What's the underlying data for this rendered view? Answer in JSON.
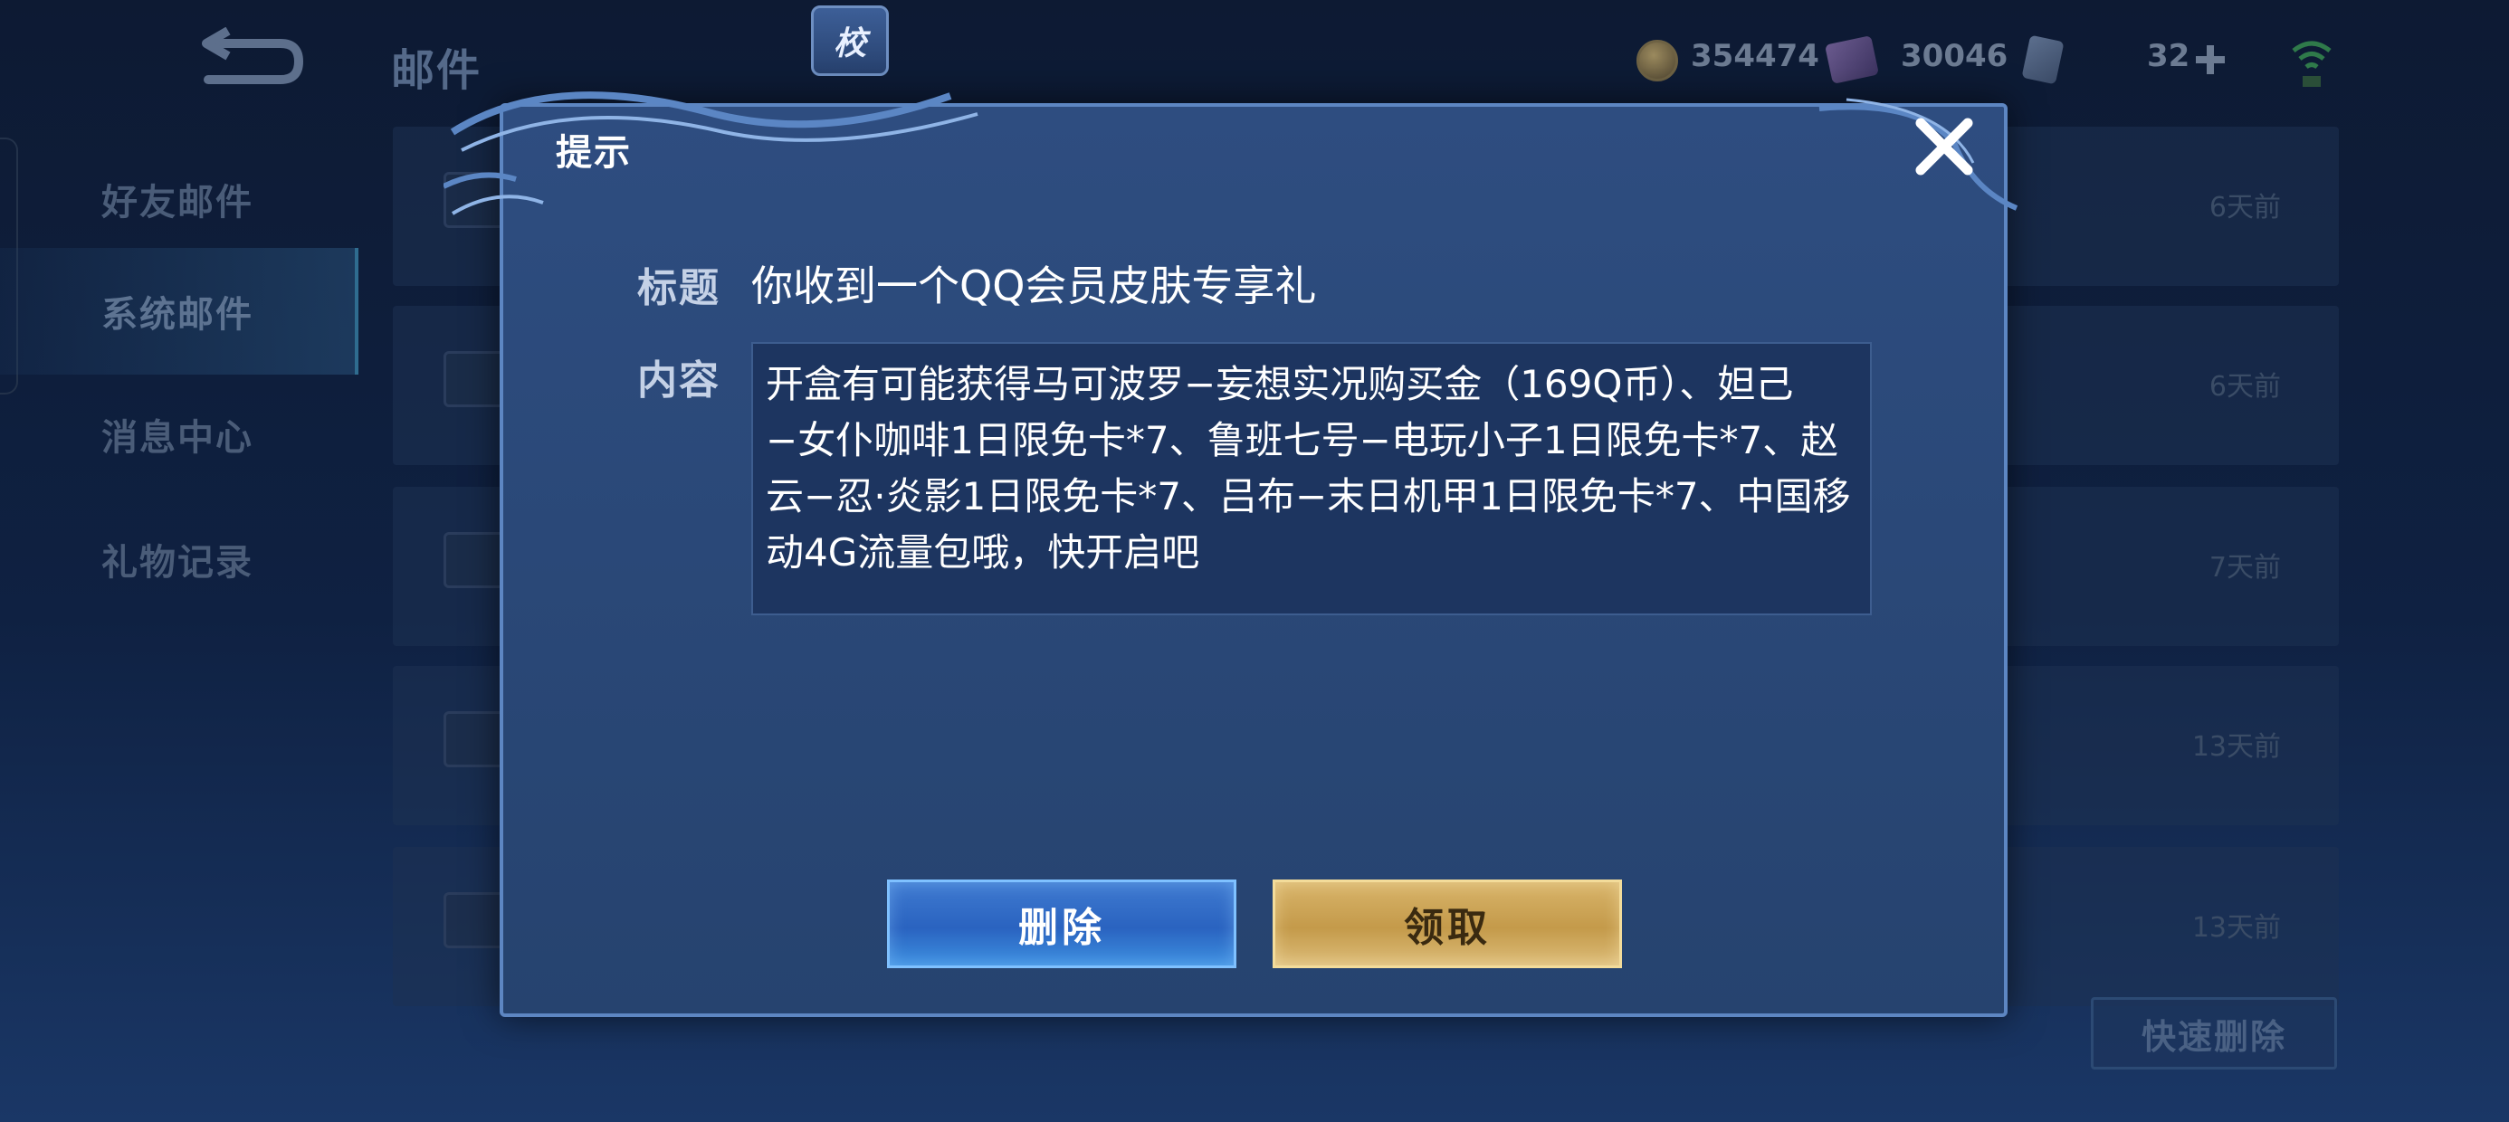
{
  "header": {
    "title": "邮件",
    "badge_glyph": "校",
    "coins": "354474",
    "gems": "30046",
    "tickets": "32"
  },
  "sidebar": {
    "items": [
      {
        "label": "好友邮件",
        "active": false
      },
      {
        "label": "系统邮件",
        "active": true
      },
      {
        "label": "消息中心",
        "active": false
      },
      {
        "label": "礼物记录",
        "active": false
      }
    ]
  },
  "mail_list": {
    "rows": [
      {
        "time": "6天前"
      },
      {
        "time": "6天前"
      },
      {
        "time": "7天前"
      },
      {
        "time": "13天前"
      },
      {
        "time": "13天前"
      }
    ],
    "quick_delete_label": "快速删除"
  },
  "dialog": {
    "title": "提示",
    "title_label": "标题",
    "title_value": "你收到一个QQ会员皮肤专享礼",
    "content_label": "内容",
    "content_value": "开盒有可能获得马可波罗−妄想实况购买金（169Q币）、妲己−女仆咖啡1日限免卡*7、鲁班七号−电玩小子1日限免卡*7、赵云−忍·炎影1日限免卡*7、吕布−末日机甲1日限免卡*7、中国移动4G流量包哦，快开启吧",
    "delete_label": "删除",
    "claim_label": "领取"
  },
  "colors": {
    "accent_blue": "#3d8fe0",
    "accent_gold": "#d8b46a",
    "dialog_bg": "#2e4d80"
  }
}
